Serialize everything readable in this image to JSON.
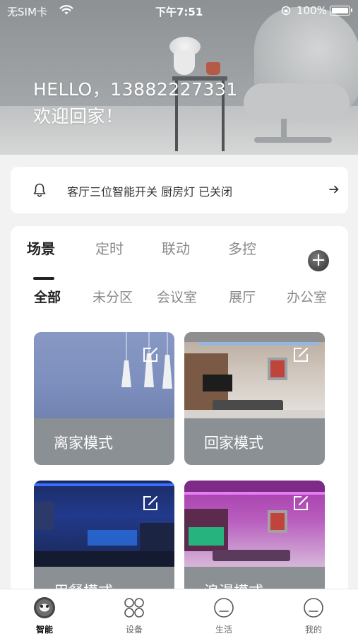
{
  "status_bar": {
    "carrier": "无SIM卡",
    "time": "下午7:51",
    "battery": "100%"
  },
  "hero": {
    "line1": "HELLO，13882227331",
    "line2": "欢迎回家！"
  },
  "notice": {
    "text": "客厅三位智能开关 厨房灯 已关闭"
  },
  "tabs": [
    "场景",
    "定时",
    "联动",
    "多控"
  ],
  "categories": [
    "全部",
    "未分区",
    "会议室",
    "展厅",
    "办公室"
  ],
  "scenes": [
    {
      "label": "离家模式"
    },
    {
      "label": "回家模式"
    },
    {
      "label": "用餐模式"
    },
    {
      "label": "浪漫模式"
    }
  ],
  "tabbar": [
    "智能",
    "设备",
    "生活",
    "我的"
  ],
  "colors": {
    "label_bar": "#8b9094",
    "accent_dark": "#222222",
    "background": "#f2f2f2"
  }
}
